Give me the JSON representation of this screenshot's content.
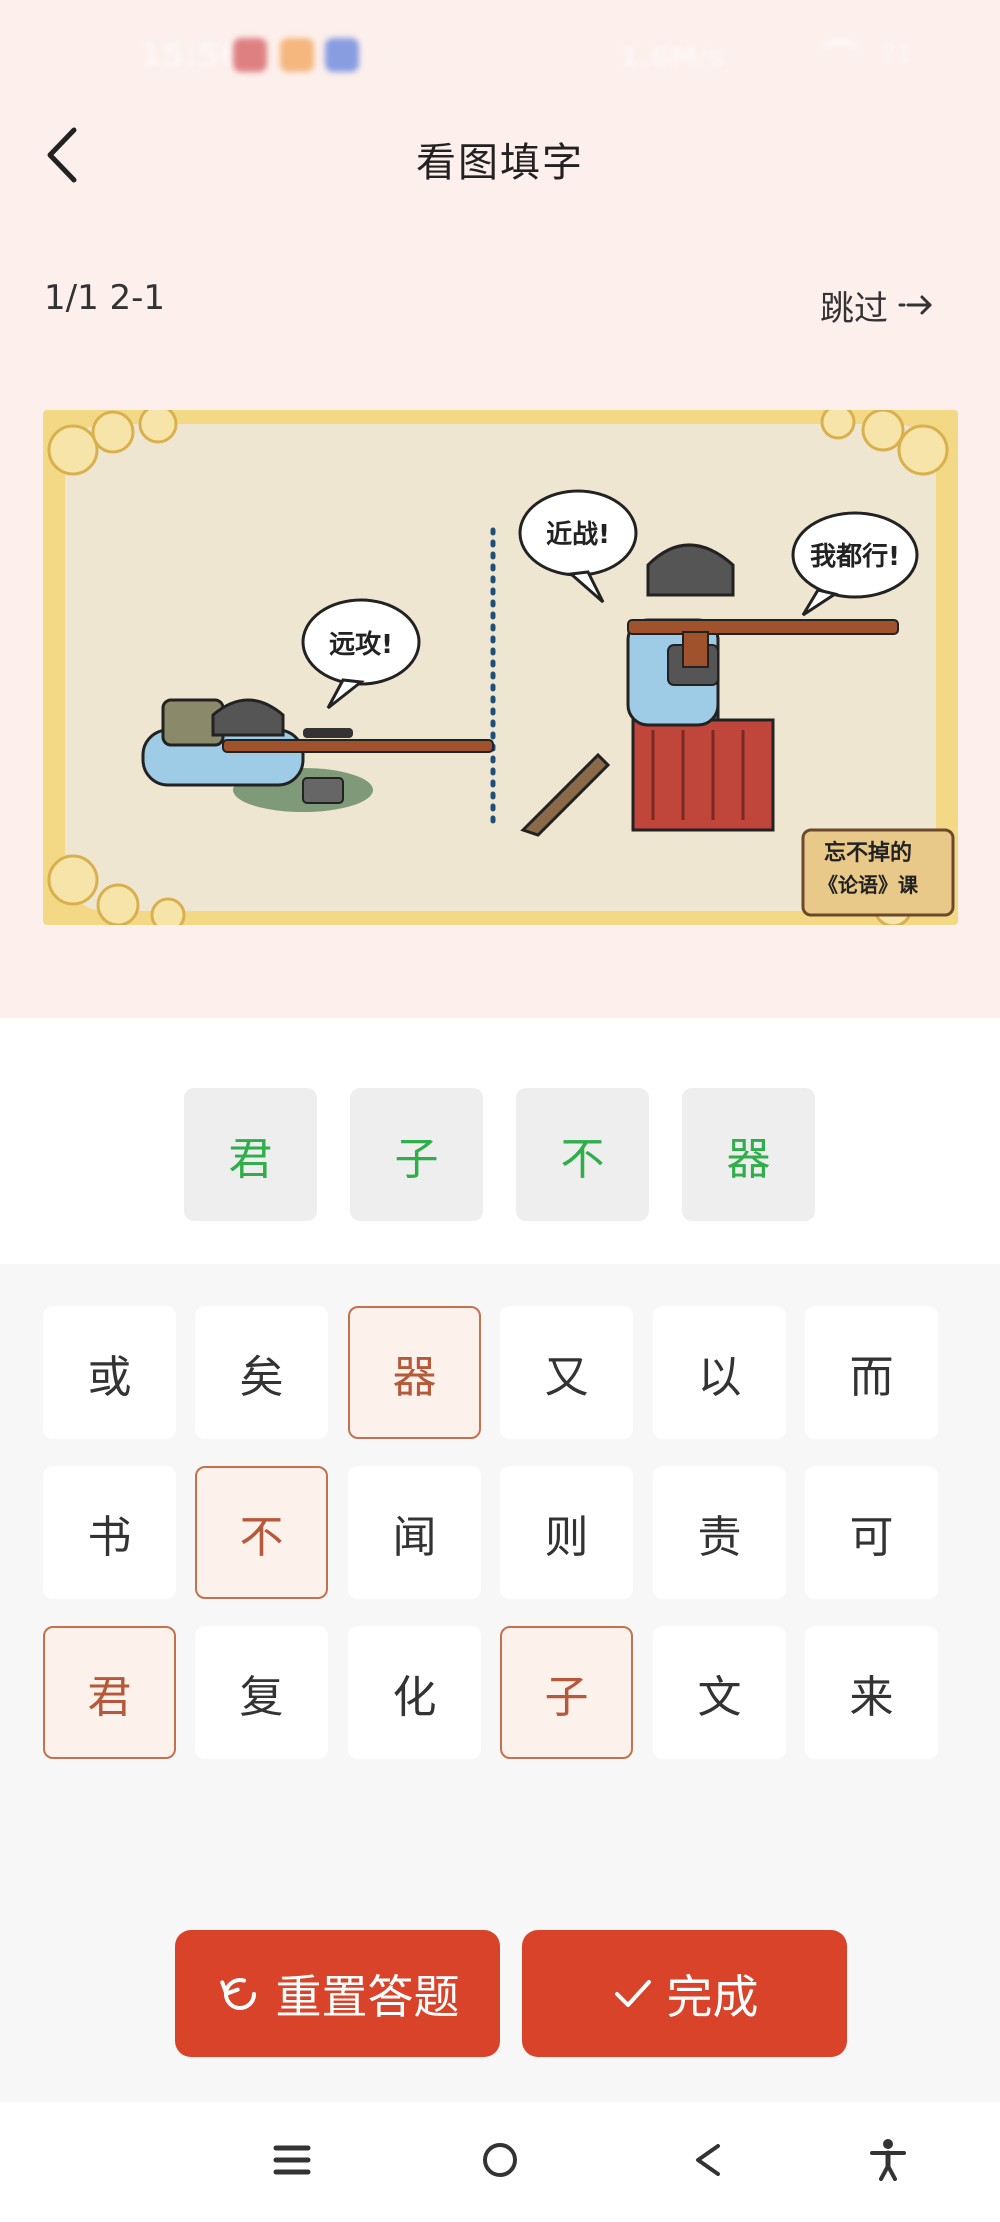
{
  "status_bar": {
    "time": "15:56",
    "network_speed": "1.6M/s",
    "battery": "71"
  },
  "header": {
    "title": "看图填字"
  },
  "progress": {
    "text": "1/1 2-1"
  },
  "skip": {
    "label": "跳过"
  },
  "comic": {
    "bubble_left": "远攻!",
    "bubble_mid": "近战!",
    "bubble_right": "我都行!",
    "scroll_line1": "忘不掉的",
    "scroll_line2": "《论语》课"
  },
  "answer_slots": [
    "君",
    "子",
    "不",
    "器"
  ],
  "candidates": [
    {
      "char": "或",
      "selected": false
    },
    {
      "char": "矣",
      "selected": false
    },
    {
      "char": "器",
      "selected": true
    },
    {
      "char": "又",
      "selected": false
    },
    {
      "char": "以",
      "selected": false
    },
    {
      "char": "而",
      "selected": false
    },
    {
      "char": "书",
      "selected": false
    },
    {
      "char": "不",
      "selected": true
    },
    {
      "char": "闻",
      "selected": false
    },
    {
      "char": "则",
      "selected": false
    },
    {
      "char": "责",
      "selected": false
    },
    {
      "char": "可",
      "selected": false
    },
    {
      "char": "君",
      "selected": true
    },
    {
      "char": "复",
      "selected": false
    },
    {
      "char": "化",
      "selected": false
    },
    {
      "char": "子",
      "selected": true
    },
    {
      "char": "文",
      "selected": false
    },
    {
      "char": "来",
      "selected": false
    }
  ],
  "actions": {
    "reset_label": "重置答题",
    "done_label": "完成"
  },
  "colors": {
    "accent": "#d9432a",
    "answer_green": "#2fae4a",
    "top_background": "#fcefec",
    "selected_border": "#c4714f"
  },
  "icons": {
    "back": "chevron-left-icon",
    "skip": "arrow-right-icon",
    "reset": "refresh-icon",
    "done": "check-icon",
    "nav_menu": "menu-icon",
    "nav_home": "home-circle-icon",
    "nav_back": "back-triangle-icon",
    "nav_accessibility": "accessibility-icon"
  }
}
